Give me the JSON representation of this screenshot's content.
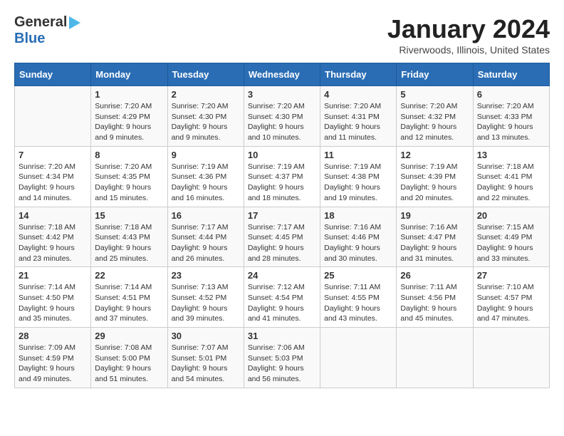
{
  "header": {
    "logo_general": "General",
    "logo_blue": "Blue",
    "title": "January 2024",
    "subtitle": "Riverwoods, Illinois, United States"
  },
  "days_of_week": [
    "Sunday",
    "Monday",
    "Tuesday",
    "Wednesday",
    "Thursday",
    "Friday",
    "Saturday"
  ],
  "weeks": [
    [
      {
        "day": "",
        "content": ""
      },
      {
        "day": "1",
        "content": "Sunrise: 7:20 AM\nSunset: 4:29 PM\nDaylight: 9 hours\nand 9 minutes."
      },
      {
        "day": "2",
        "content": "Sunrise: 7:20 AM\nSunset: 4:30 PM\nDaylight: 9 hours\nand 9 minutes."
      },
      {
        "day": "3",
        "content": "Sunrise: 7:20 AM\nSunset: 4:30 PM\nDaylight: 9 hours\nand 10 minutes."
      },
      {
        "day": "4",
        "content": "Sunrise: 7:20 AM\nSunset: 4:31 PM\nDaylight: 9 hours\nand 11 minutes."
      },
      {
        "day": "5",
        "content": "Sunrise: 7:20 AM\nSunset: 4:32 PM\nDaylight: 9 hours\nand 12 minutes."
      },
      {
        "day": "6",
        "content": "Sunrise: 7:20 AM\nSunset: 4:33 PM\nDaylight: 9 hours\nand 13 minutes."
      }
    ],
    [
      {
        "day": "7",
        "content": ""
      },
      {
        "day": "8",
        "content": "Sunrise: 7:20 AM\nSunset: 4:35 PM\nDaylight: 9 hours\nand 15 minutes."
      },
      {
        "day": "9",
        "content": "Sunrise: 7:19 AM\nSunset: 4:36 PM\nDaylight: 9 hours\nand 16 minutes."
      },
      {
        "day": "10",
        "content": "Sunrise: 7:19 AM\nSunset: 4:37 PM\nDaylight: 9 hours\nand 18 minutes."
      },
      {
        "day": "11",
        "content": "Sunrise: 7:19 AM\nSunset: 4:38 PM\nDaylight: 9 hours\nand 19 minutes."
      },
      {
        "day": "12",
        "content": "Sunrise: 7:19 AM\nSunset: 4:39 PM\nDaylight: 9 hours\nand 20 minutes."
      },
      {
        "day": "13",
        "content": "Sunrise: 7:18 AM\nSunset: 4:41 PM\nDaylight: 9 hours\nand 22 minutes."
      }
    ],
    [
      {
        "day": "14",
        "content": ""
      },
      {
        "day": "15",
        "content": "Sunrise: 7:18 AM\nSunset: 4:43 PM\nDaylight: 9 hours\nand 25 minutes."
      },
      {
        "day": "16",
        "content": "Sunrise: 7:17 AM\nSunset: 4:44 PM\nDaylight: 9 hours\nand 26 minutes."
      },
      {
        "day": "17",
        "content": "Sunrise: 7:17 AM\nSunset: 4:45 PM\nDaylight: 9 hours\nand 28 minutes."
      },
      {
        "day": "18",
        "content": "Sunrise: 7:16 AM\nSunset: 4:46 PM\nDaylight: 9 hours\nand 30 minutes."
      },
      {
        "day": "19",
        "content": "Sunrise: 7:16 AM\nSunset: 4:47 PM\nDaylight: 9 hours\nand 31 minutes."
      },
      {
        "day": "20",
        "content": "Sunrise: 7:15 AM\nSunset: 4:49 PM\nDaylight: 9 hours\nand 33 minutes."
      }
    ],
    [
      {
        "day": "21",
        "content": ""
      },
      {
        "day": "22",
        "content": "Sunrise: 7:14 AM\nSunset: 4:51 PM\nDaylight: 9 hours\nand 37 minutes."
      },
      {
        "day": "23",
        "content": "Sunrise: 7:13 AM\nSunset: 4:52 PM\nDaylight: 9 hours\nand 39 minutes."
      },
      {
        "day": "24",
        "content": "Sunrise: 7:12 AM\nSunset: 4:54 PM\nDaylight: 9 hours\nand 41 minutes."
      },
      {
        "day": "25",
        "content": "Sunrise: 7:11 AM\nSunset: 4:55 PM\nDaylight: 9 hours\nand 43 minutes."
      },
      {
        "day": "26",
        "content": "Sunrise: 7:11 AM\nSunset: 4:56 PM\nDaylight: 9 hours\nand 45 minutes."
      },
      {
        "day": "27",
        "content": "Sunrise: 7:10 AM\nSunset: 4:57 PM\nDaylight: 9 hours\nand 47 minutes."
      }
    ],
    [
      {
        "day": "28",
        "content": ""
      },
      {
        "day": "29",
        "content": "Sunrise: 7:08 AM\nSunset: 5:00 PM\nDaylight: 9 hours\nand 51 minutes."
      },
      {
        "day": "30",
        "content": "Sunrise: 7:07 AM\nSunset: 5:01 PM\nDaylight: 9 hours\nand 54 minutes."
      },
      {
        "day": "31",
        "content": "Sunrise: 7:06 AM\nSunset: 5:03 PM\nDaylight: 9 hours\nand 56 minutes."
      },
      {
        "day": "",
        "content": ""
      },
      {
        "day": "",
        "content": ""
      },
      {
        "day": "",
        "content": ""
      }
    ]
  ],
  "week_sunday_content": [
    {
      "day": "7",
      "content": "Sunrise: 7:20 AM\nSunset: 4:34 PM\nDaylight: 9 hours\nand 14 minutes."
    },
    {
      "day": "14",
      "content": "Sunrise: 7:18 AM\nSunset: 4:42 PM\nDaylight: 9 hours\nand 23 minutes."
    },
    {
      "day": "21",
      "content": "Sunrise: 7:14 AM\nSunset: 4:50 PM\nDaylight: 9 hours\nand 35 minutes."
    },
    {
      "day": "28",
      "content": "Sunrise: 7:09 AM\nSunset: 4:59 PM\nDaylight: 9 hours\nand 49 minutes."
    }
  ]
}
